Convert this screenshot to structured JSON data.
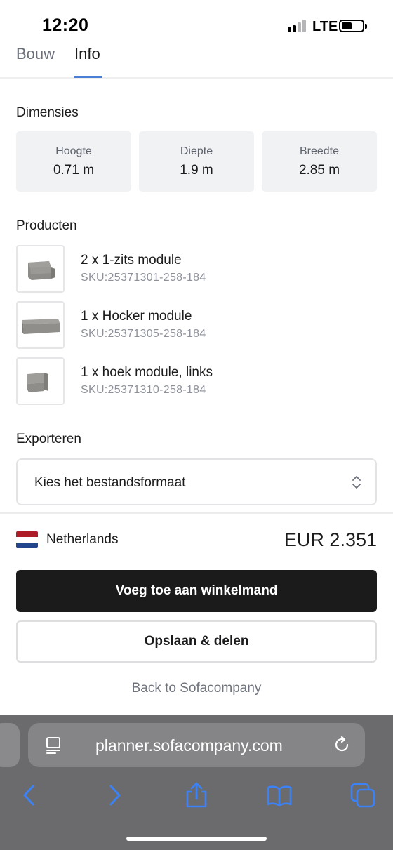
{
  "status_bar": {
    "time": "12:20",
    "network": "LTE"
  },
  "tabs": [
    {
      "label": "Bouw",
      "active": false
    },
    {
      "label": "Info",
      "active": true
    }
  ],
  "dimensions": {
    "title": "Dimensies",
    "items": [
      {
        "label": "Hoogte",
        "value": "0.71 m"
      },
      {
        "label": "Diepte",
        "value": "1.9 m"
      },
      {
        "label": "Breedte",
        "value": "2.85 m"
      }
    ]
  },
  "products": {
    "title": "Producten",
    "items": [
      {
        "name": "2 x 1-zits module",
        "sku": "SKU:25371301-258-184"
      },
      {
        "name": "1 x Hocker module",
        "sku": "SKU:25371305-258-184"
      },
      {
        "name": "1 x hoek module, links",
        "sku": "SKU:25371310-258-184"
      }
    ]
  },
  "export": {
    "title": "Exporteren",
    "select_value": "Kies het bestandsformaat"
  },
  "checkout": {
    "country": "Netherlands",
    "price": "EUR 2.351",
    "add_to_cart_label": "Voeg toe aan winkelmand",
    "save_share_label": "Opslaan & delen",
    "back_link": "Back to Sofacompany"
  },
  "browser": {
    "url": "planner.sofacompany.com"
  },
  "colors": {
    "accent": "#4a7fd4",
    "primary_button": "#1b1b1b",
    "card_bg": "#f1f2f4",
    "flag_red": "#ae1c28",
    "flag_white": "#ffffff",
    "flag_blue": "#21468b",
    "browser_bar": "#6b6b6d",
    "browser_icon": "#3b82f6"
  },
  "icons": {
    "url_page": "page-icon",
    "reload": "reload-icon",
    "back": "chevron-left-icon",
    "forward": "chevron-right-icon",
    "share": "share-icon",
    "bookmarks": "book-icon",
    "tabs": "tabs-icon"
  }
}
